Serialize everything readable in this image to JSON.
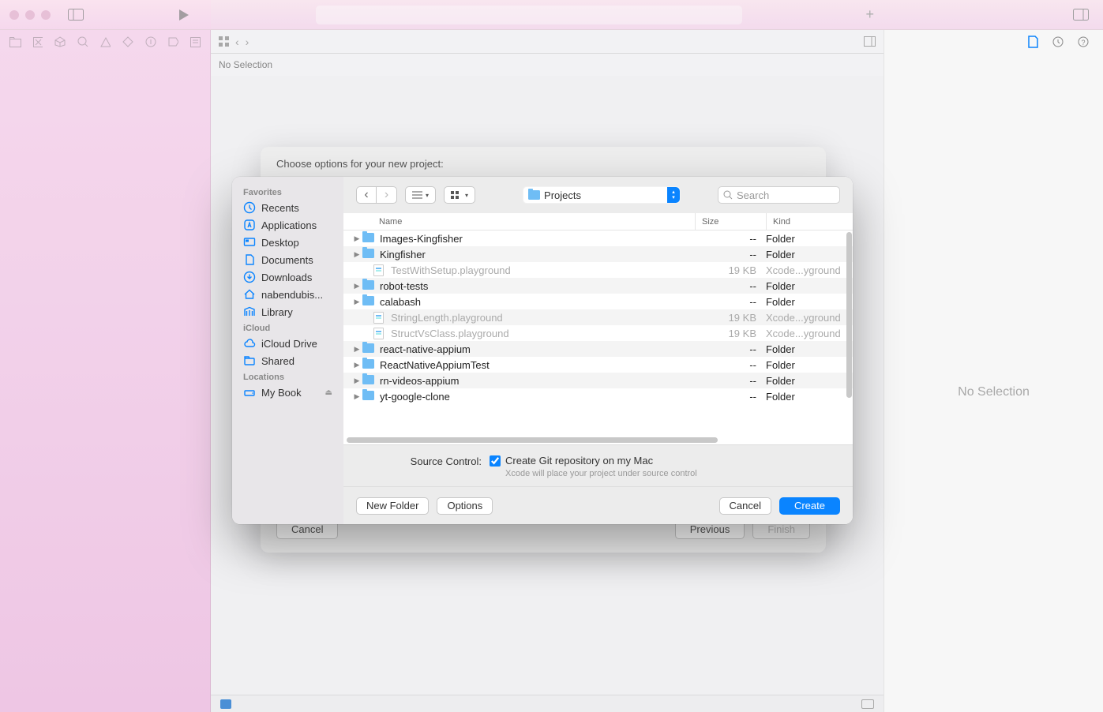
{
  "editor_status": "No Selection",
  "inspector_empty": "No Selection",
  "options_sheet": {
    "title": "Choose options for your new project:",
    "cancel": "Cancel",
    "previous": "Previous",
    "finish": "Finish"
  },
  "dialog": {
    "sidebar": {
      "sections": [
        {
          "title": "Favorites",
          "items": [
            {
              "icon": "clock",
              "label": "Recents"
            },
            {
              "icon": "app",
              "label": "Applications"
            },
            {
              "icon": "desktop",
              "label": "Desktop"
            },
            {
              "icon": "doc",
              "label": "Documents"
            },
            {
              "icon": "download",
              "label": "Downloads"
            },
            {
              "icon": "home",
              "label": "nabendubis..."
            },
            {
              "icon": "library",
              "label": "Library"
            }
          ]
        },
        {
          "title": "iCloud",
          "items": [
            {
              "icon": "cloud",
              "label": "iCloud Drive"
            },
            {
              "icon": "shared",
              "label": "Shared"
            }
          ]
        },
        {
          "title": "Locations",
          "items": [
            {
              "icon": "disk",
              "label": "My Book",
              "eject": true
            }
          ]
        }
      ]
    },
    "location": "Projects",
    "search_placeholder": "Search",
    "columns": {
      "name": "Name",
      "size": "Size",
      "kind": "Kind"
    },
    "files": [
      {
        "name": "Images-Kingfisher",
        "size": "--",
        "kind": "Folder",
        "type": "folder"
      },
      {
        "name": "Kingfisher",
        "size": "--",
        "kind": "Folder",
        "type": "folder"
      },
      {
        "name": "TestWithSetup.playground",
        "size": "19 KB",
        "kind": "Xcode...yground",
        "type": "pg",
        "dimmed": true
      },
      {
        "name": "robot-tests",
        "size": "--",
        "kind": "Folder",
        "type": "folder"
      },
      {
        "name": "calabash",
        "size": "--",
        "kind": "Folder",
        "type": "folder"
      },
      {
        "name": "StringLength.playground",
        "size": "19 KB",
        "kind": "Xcode...yground",
        "type": "pg",
        "dimmed": true
      },
      {
        "name": "StructVsClass.playground",
        "size": "19 KB",
        "kind": "Xcode...yground",
        "type": "pg",
        "dimmed": true
      },
      {
        "name": "react-native-appium",
        "size": "--",
        "kind": "Folder",
        "type": "folder"
      },
      {
        "name": "ReactNativeAppiumTest",
        "size": "--",
        "kind": "Folder",
        "type": "folder"
      },
      {
        "name": "rn-videos-appium",
        "size": "--",
        "kind": "Folder",
        "type": "folder"
      },
      {
        "name": "yt-google-clone",
        "size": "--",
        "kind": "Folder",
        "type": "folder"
      }
    ],
    "source_control": {
      "label": "Source Control:",
      "checkbox": "Create Git repository on my Mac",
      "hint": "Xcode will place your project under source control"
    },
    "buttons": {
      "new_folder": "New Folder",
      "options": "Options",
      "cancel": "Cancel",
      "create": "Create"
    }
  }
}
